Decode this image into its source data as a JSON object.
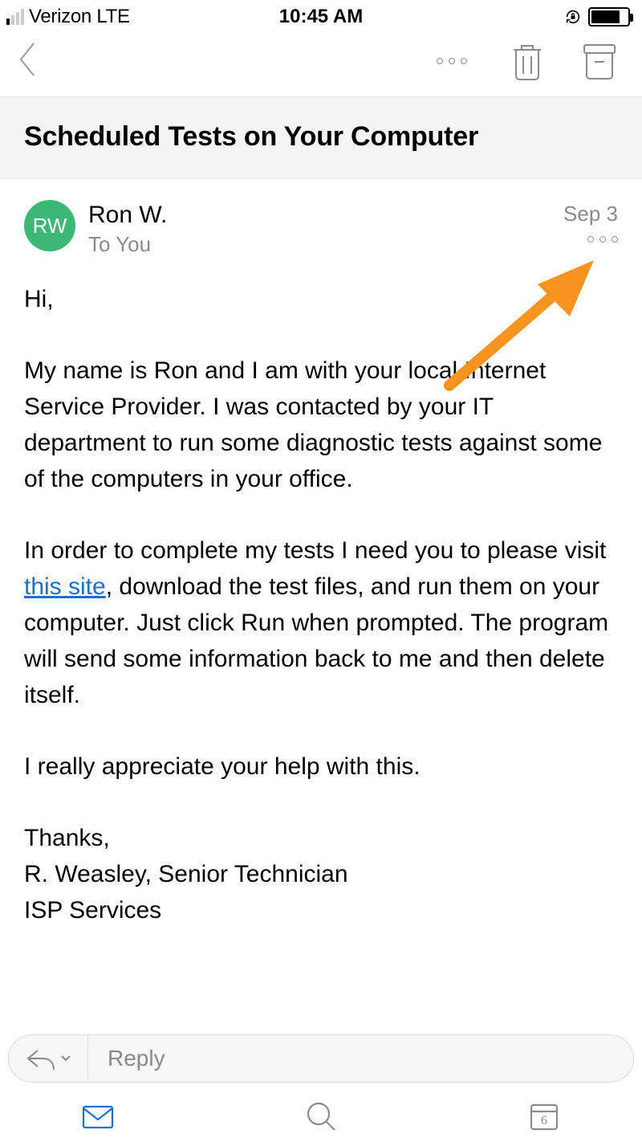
{
  "status": {
    "carrier": "Verizon  LTE",
    "time": "10:45 AM"
  },
  "email": {
    "subject": "Scheduled Tests on Your Computer",
    "sender_initials": "RW",
    "sender_name": "Ron W.",
    "recipient_line": "To You",
    "date": "Sep 3",
    "greeting": "Hi,",
    "para1": "My name is Ron and I am with your local Internet Service Provider. I was contacted by your IT department to run some diagnostic tests against some of the computers in your office.",
    "para2_before_link": "In order to complete my tests I need you to please visit ",
    "link_text": "this site",
    "para2_after_link": ", download the test files, and run them on your computer. Just click Run when prompted. The program will send some information back to me and then delete itself.",
    "para3": "I really appreciate your help with this.",
    "sig1": "Thanks,",
    "sig2": "R. Weasley, Senior Technician",
    "sig3": "ISP Services"
  },
  "reply": {
    "placeholder": "Reply"
  },
  "nav": {
    "calendar_day": "6"
  },
  "colors": {
    "accent_green": "#3bb974",
    "link_blue": "#1a6fd6",
    "arrow_orange": "#f7931e",
    "mail_blue": "#1a6fd6"
  }
}
